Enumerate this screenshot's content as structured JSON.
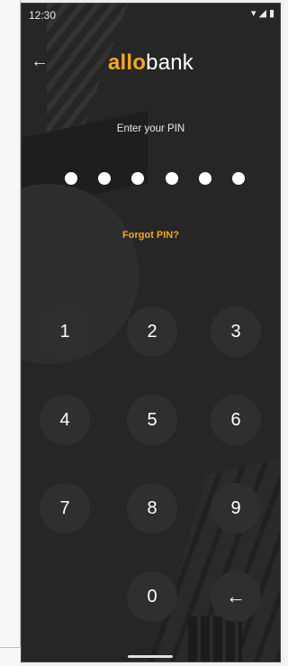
{
  "status_bar": {
    "time": "12:30"
  },
  "header": {
    "logo_highlight": "allo",
    "logo_rest": "bank"
  },
  "pin": {
    "prompt": "Enter your PIN",
    "entered_count": 6,
    "forgot_label": "Forgot PIN?"
  },
  "keypad": {
    "k1": "1",
    "k2": "2",
    "k3": "3",
    "k4": "4",
    "k5": "5",
    "k6": "6",
    "k7": "7",
    "k8": "8",
    "k9": "9",
    "k0": "0"
  },
  "colors": {
    "accent": "#f5a623",
    "background": "#262626",
    "key": "#2f2f2f"
  }
}
